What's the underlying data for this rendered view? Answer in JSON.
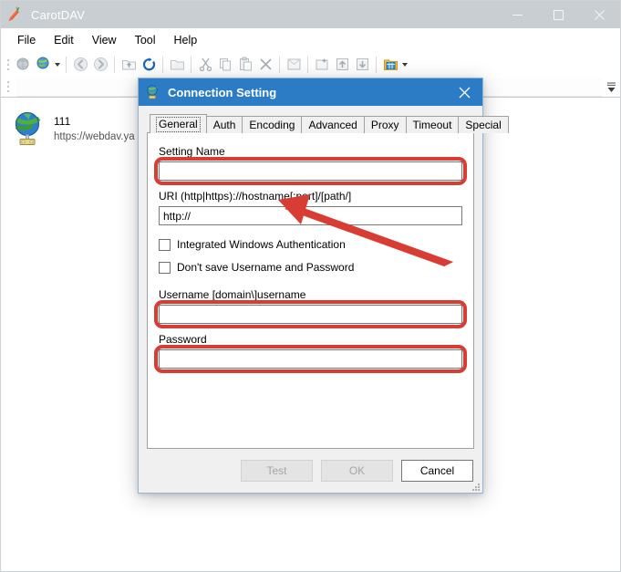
{
  "app": {
    "title": "CarotDAV",
    "icon": "carrot-icon",
    "window_controls": {
      "minimize": "minimize-icon",
      "maximize": "maximize-icon",
      "close": "close-icon"
    }
  },
  "menu": {
    "items": [
      {
        "label": "File"
      },
      {
        "label": "Edit"
      },
      {
        "label": "View"
      },
      {
        "label": "Tool"
      },
      {
        "label": "Help"
      }
    ]
  },
  "toolbar": {
    "buttons": [
      {
        "name": "connect-icon"
      },
      {
        "name": "new-connection-icon"
      },
      {
        "name": "connection-dropdown-caret"
      },
      {
        "name": "back-icon"
      },
      {
        "name": "forward-icon"
      },
      {
        "name": "up-folder-icon"
      },
      {
        "name": "refresh-icon"
      },
      {
        "name": "new-folder-icon"
      },
      {
        "name": "cut-icon"
      },
      {
        "name": "copy-icon"
      },
      {
        "name": "paste-icon"
      },
      {
        "name": "delete-icon"
      },
      {
        "name": "properties-icon"
      },
      {
        "name": "rename-icon"
      },
      {
        "name": "upload-icon"
      },
      {
        "name": "download-icon"
      },
      {
        "name": "view-mode-icon"
      },
      {
        "name": "view-mode-caret"
      }
    ],
    "overflow": "toolbar-overflow-icon"
  },
  "address": {
    "value": "",
    "placeholder": ""
  },
  "file_list": {
    "entries": [
      {
        "icon": "webdav-globe-icon",
        "name": "111",
        "url": "https://webdav.ya"
      }
    ]
  },
  "dialog": {
    "title": "Connection Setting",
    "icon": "connection-icon",
    "close": "close-icon",
    "tabs": [
      {
        "label": "General",
        "selected": true
      },
      {
        "label": "Auth",
        "selected": false
      },
      {
        "label": "Encoding",
        "selected": false
      },
      {
        "label": "Advanced",
        "selected": false
      },
      {
        "label": "Proxy",
        "selected": false
      },
      {
        "label": "Timeout",
        "selected": false
      },
      {
        "label": "Special",
        "selected": false
      }
    ],
    "general": {
      "setting_name": {
        "label": "Setting Name",
        "value": "",
        "placeholder": "",
        "highlighted": true
      },
      "uri": {
        "label": "URI  (http|https)://hostname[:port]/[path/]",
        "value": "http://",
        "placeholder": "",
        "highlighted": false
      },
      "integrated_auth": {
        "label": "Integrated Windows Authentication",
        "checked": false
      },
      "dont_save": {
        "label": "Don't save Username and Password",
        "checked": false
      },
      "username": {
        "label": "Username  [domain\\]username",
        "value": "",
        "placeholder": "",
        "highlighted": true
      },
      "password": {
        "label": "Password",
        "value": "",
        "placeholder": "",
        "highlighted": true
      }
    },
    "buttons": {
      "test": {
        "label": "Test",
        "enabled": false
      },
      "ok": {
        "label": "OK",
        "enabled": false
      },
      "cancel": {
        "label": "Cancel",
        "enabled": true
      }
    }
  },
  "annotation": {
    "color": "#d93c33",
    "arrow": "red-arrow-pointing-to-uri-field",
    "highlight_boxes": 3
  }
}
